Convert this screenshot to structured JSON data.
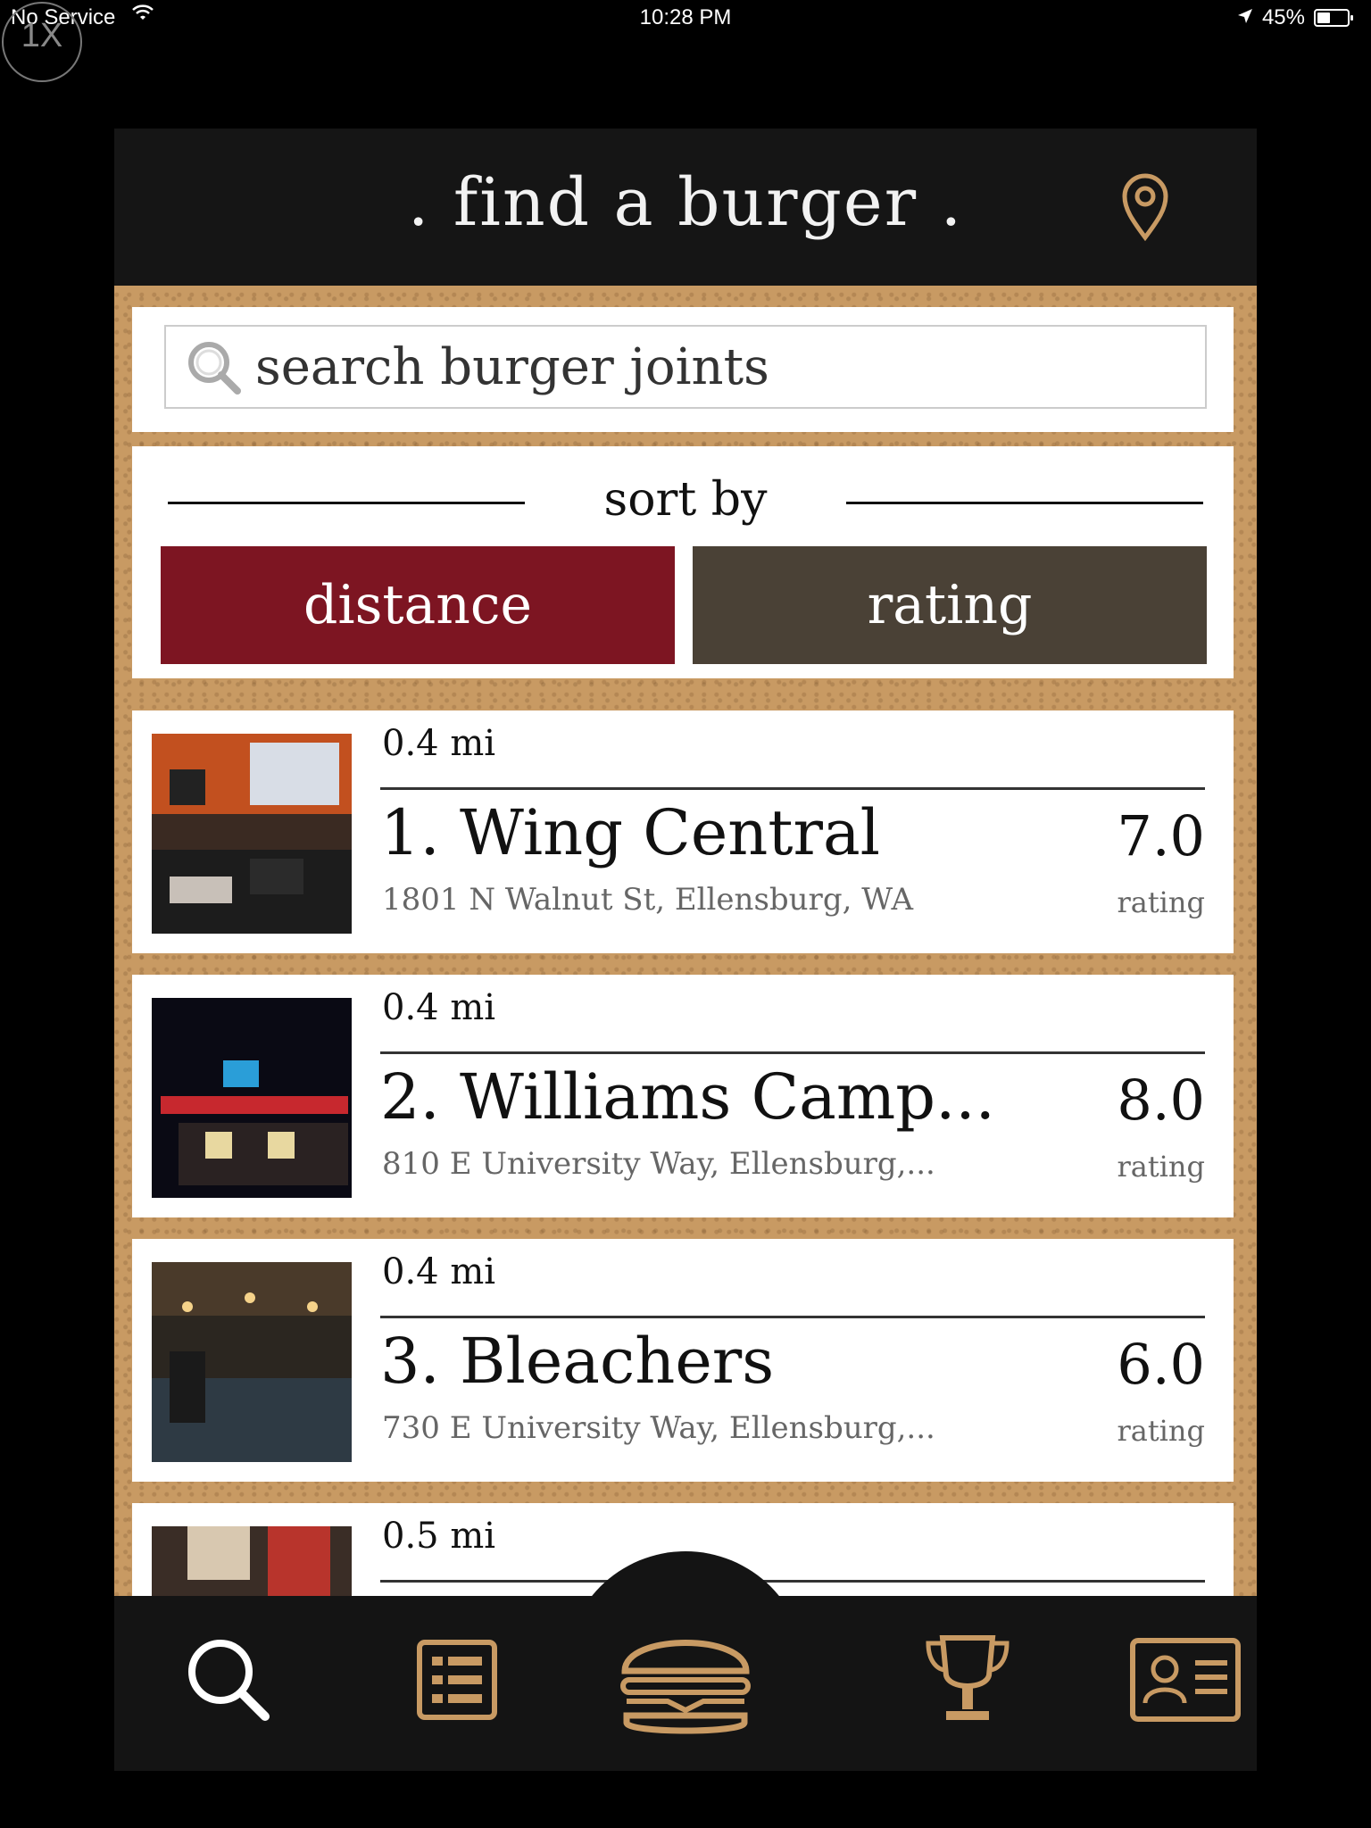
{
  "status_bar": {
    "carrier": "No Service",
    "time": "10:28 PM",
    "battery": "45%",
    "battery_level": 0.45,
    "zoom_badge": "1X"
  },
  "header": {
    "title": ". find a burger .",
    "location_icon": "map-pin-icon"
  },
  "search": {
    "placeholder": "search burger joints",
    "value": ""
  },
  "sort": {
    "label": "sort by",
    "options": [
      "distance",
      "rating"
    ],
    "selected": "distance"
  },
  "restaurants": [
    {
      "distance": "0.4 mi",
      "name": "1. Wing Central",
      "address": "1801 N Walnut St, Ellensburg, WA",
      "rating": "7.0",
      "rating_label": "rating"
    },
    {
      "distance": "0.4 mi",
      "name": "2. Williams Camp...",
      "address": "810 E University Way, Ellensburg,...",
      "rating": "8.0",
      "rating_label": "rating"
    },
    {
      "distance": "0.4 mi",
      "name": "3. Bleachers",
      "address": "730 E University Way, Ellensburg,...",
      "rating": "6.0",
      "rating_label": "rating"
    },
    {
      "distance": "0.5 mi",
      "name": "",
      "address": "",
      "rating": "",
      "rating_label": ""
    }
  ],
  "tabs": [
    {
      "icon": "search-icon",
      "active": true
    },
    {
      "icon": "list-icon",
      "active": false
    },
    {
      "icon": "burger-icon",
      "active": false
    },
    {
      "icon": "trophy-icon",
      "active": false
    },
    {
      "icon": "profile-card-icon",
      "active": false
    }
  ],
  "colors": {
    "distance_button": "#7d1522",
    "rating_button": "#4a4136",
    "accent_gold": "#c89a63",
    "header_bg": "#151515"
  }
}
